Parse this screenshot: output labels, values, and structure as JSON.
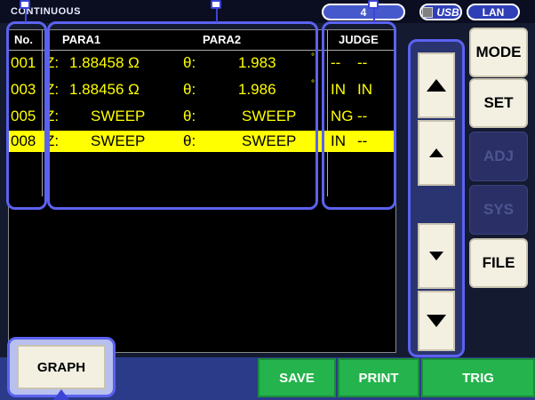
{
  "title": "CONTINUOUS",
  "status": {
    "count": "4",
    "usb": "USB",
    "lan": "LAN"
  },
  "table": {
    "headers": {
      "no": "No.",
      "para1": "PARA1",
      "para2": "PARA2",
      "judge": "JUDGE"
    },
    "rows": [
      {
        "no": "001",
        "p1_label": "Z:",
        "p1_value": "1.88458 Ω",
        "p2_label": "θ:",
        "p2_value": "1.983",
        "p2_unit": "°",
        "j1": "--",
        "j2": "--"
      },
      {
        "no": "003",
        "p1_label": "Z:",
        "p1_value": "1.88456 Ω",
        "p2_label": "θ:",
        "p2_value": "1.986",
        "p2_unit": "°",
        "j1": "IN",
        "j2": "IN"
      },
      {
        "no": "005",
        "p1_label": "Z:",
        "p1_value": "SWEEP",
        "p2_label": "θ:",
        "p2_value": "SWEEP",
        "p2_unit": "",
        "j1": "NG",
        "j2": "--"
      },
      {
        "no": "008",
        "p1_label": "Z:",
        "p1_value": "SWEEP",
        "p2_label": "θ:",
        "p2_value": "SWEEP",
        "p2_unit": "",
        "j1": "IN",
        "j2": "--"
      }
    ],
    "selected_row_no": "008"
  },
  "side_menu": {
    "mode": "MODE",
    "set": "SET",
    "adj": "ADJ",
    "sys": "SYS",
    "file": "FILE"
  },
  "scroll_buttons": {
    "page_up": "page-up-icon",
    "up": "up-icon",
    "down": "down-icon",
    "page_down": "page-down-icon"
  },
  "bottom": {
    "graph": "GRAPH",
    "save": "SAVE",
    "print": "PRINT",
    "trig": "TRIG"
  },
  "colors": {
    "value_text": "#ffff00",
    "selected_row_bg": "#ffff00",
    "action_button": "#24b34c",
    "callout": "#5b62f0"
  }
}
